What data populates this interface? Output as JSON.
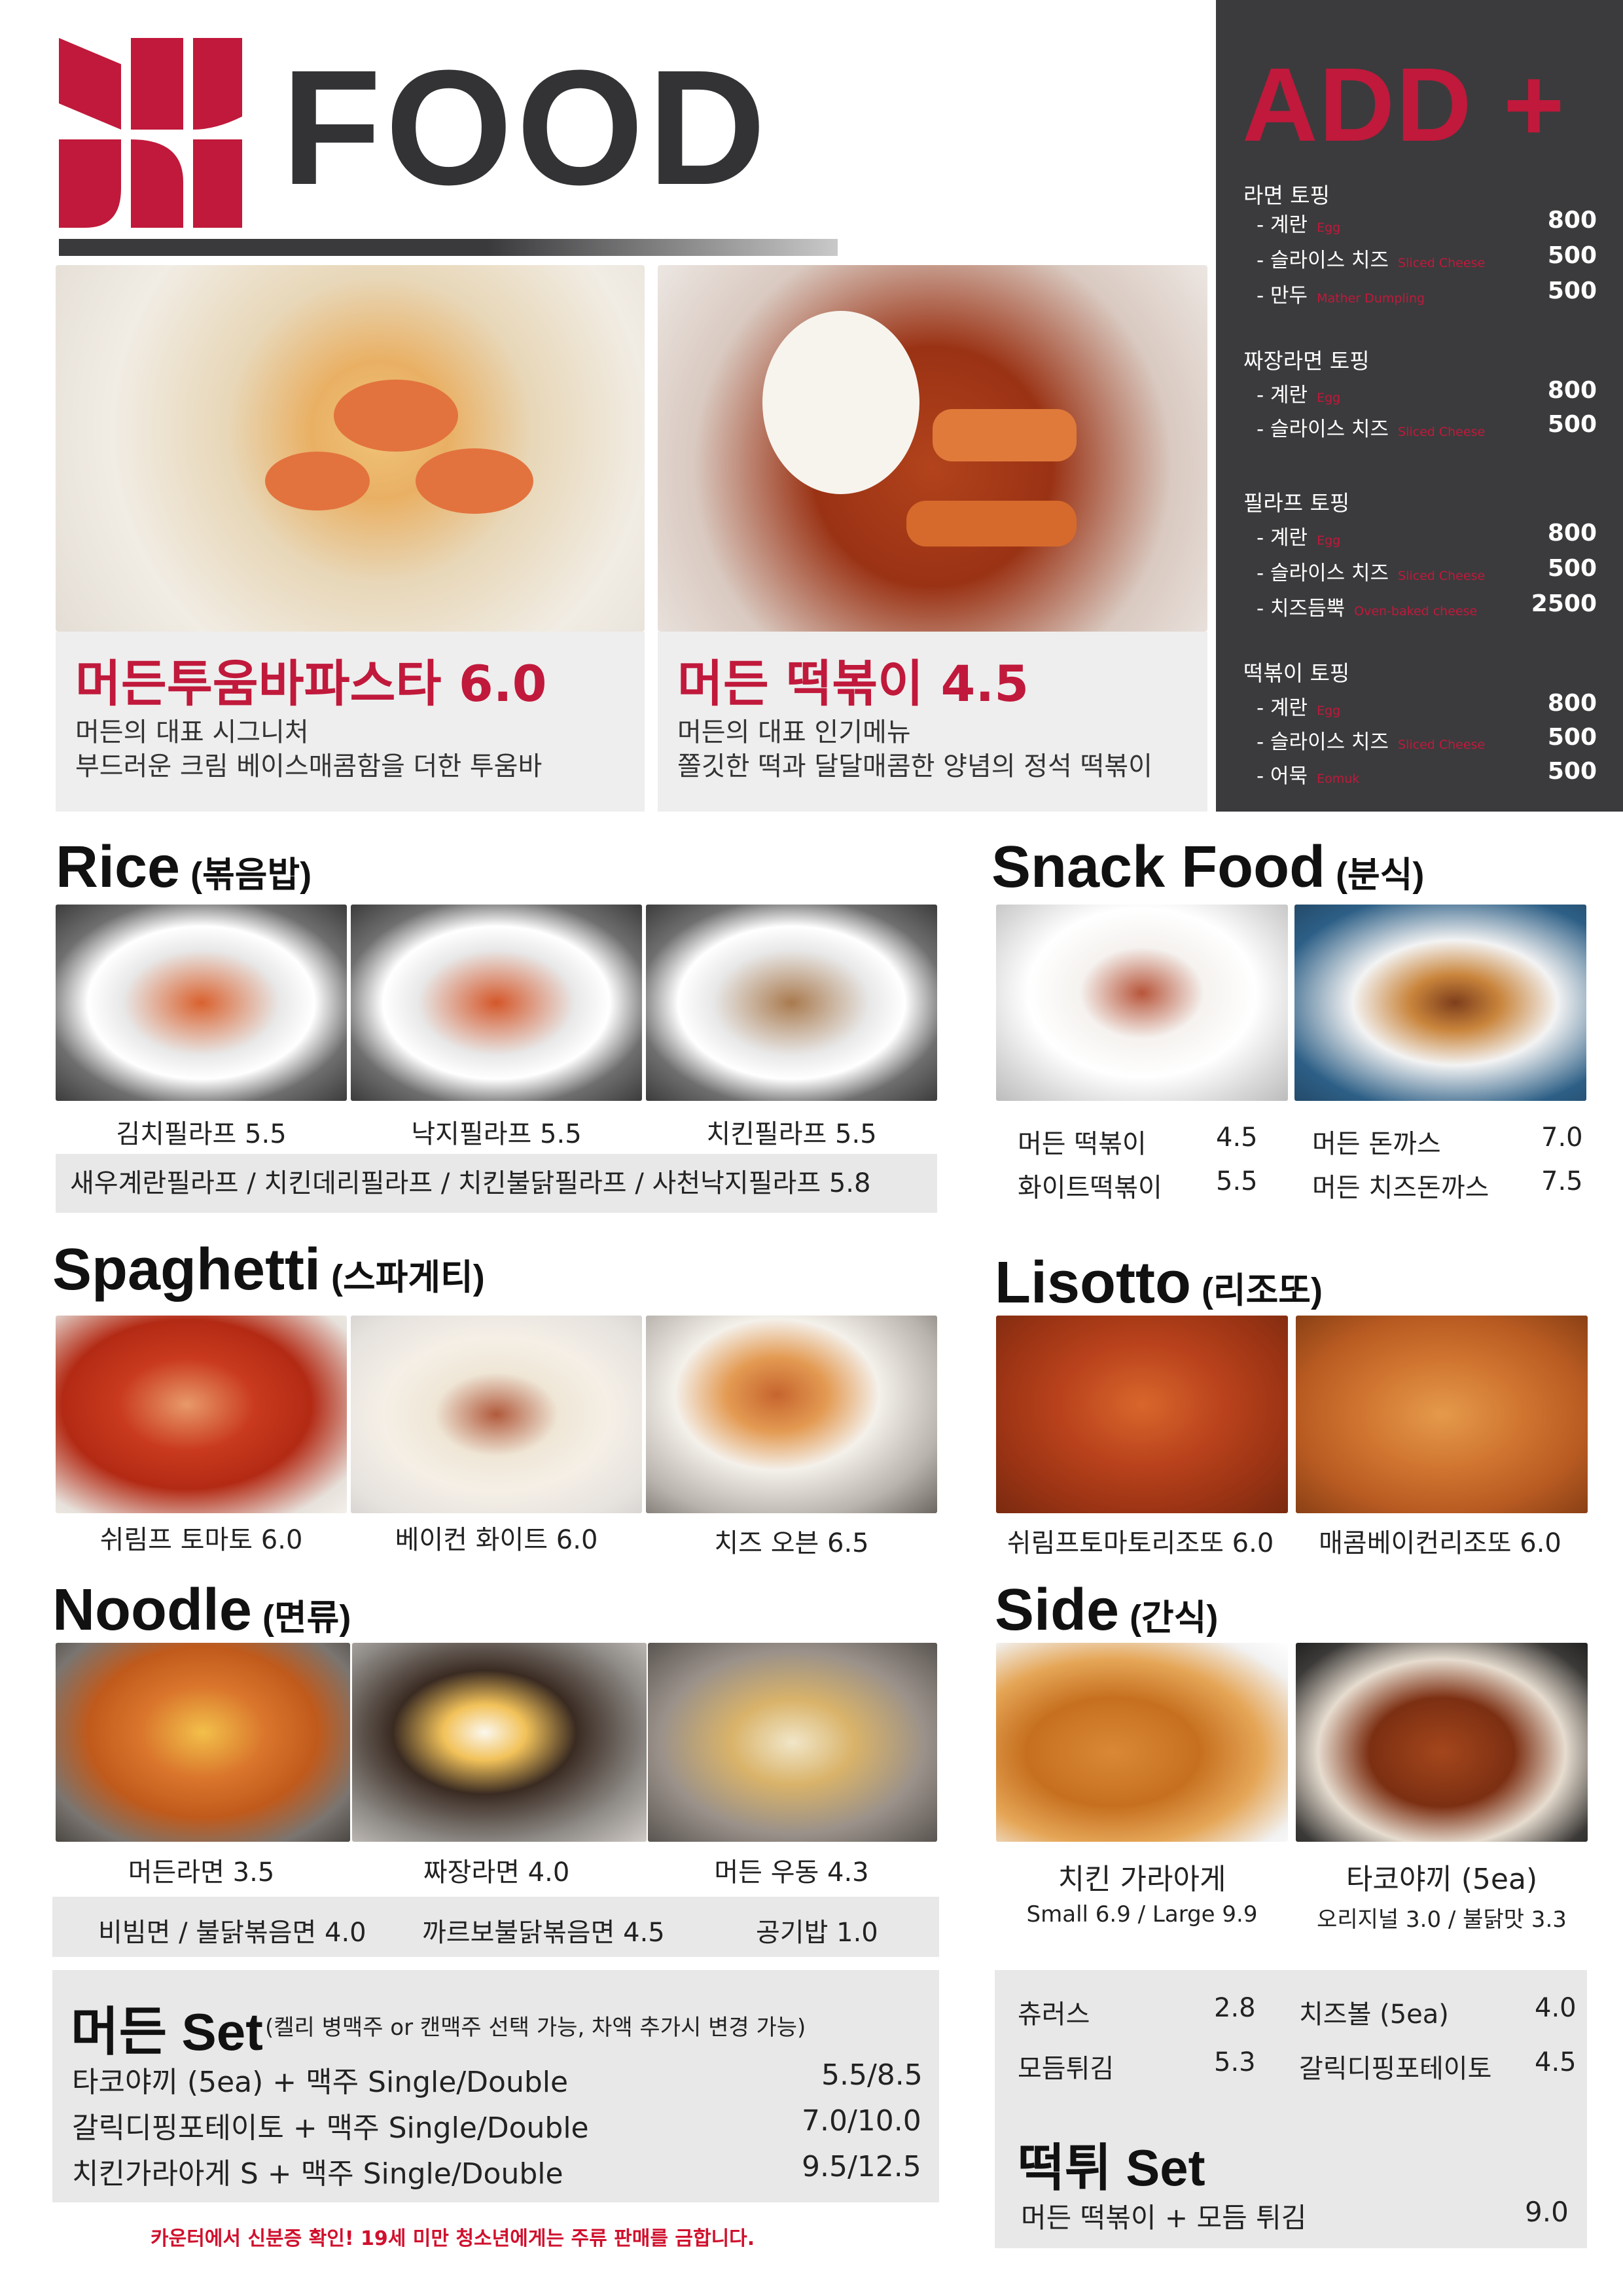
{
  "header": {
    "title": "FOOD"
  },
  "colors": {
    "brand": "#c0193b",
    "panel": "#3b3b3d",
    "bar": "#e8e8e8"
  },
  "hero": [
    {
      "title": "머든투움바파스타 6.0",
      "desc": "머든의 대표 시그니처\n부드러운 크림 베이스매콤함을 더한 투움바"
    },
    {
      "title": "머든 떡볶이 4.5",
      "desc": "머든의 대표 인기메뉴\n쫄깃한 떡과 달달매콤한 양념의 정석 떡볶이"
    }
  ],
  "add": {
    "title": "ADD +",
    "groups": [
      {
        "title": "라면 토핑",
        "items": [
          {
            "name": "- 계란",
            "en": "Egg",
            "price": "800"
          },
          {
            "name": "- 슬라이스 치즈",
            "en": "Sliced Cheese",
            "price": "500"
          },
          {
            "name": "- 만두",
            "en": "Mather Dumpling",
            "price": "500"
          }
        ]
      },
      {
        "title": "짜장라면 토핑",
        "items": [
          {
            "name": "- 계란",
            "en": "Egg",
            "price": "800"
          },
          {
            "name": "- 슬라이스 치즈",
            "en": "Sliced Cheese",
            "price": "500"
          }
        ]
      },
      {
        "title": "필라프 토핑",
        "items": [
          {
            "name": "- 계란",
            "en": "Egg",
            "price": "800"
          },
          {
            "name": "- 슬라이스 치즈",
            "en": "Sliced Cheese",
            "price": "500"
          },
          {
            "name": "- 치즈듬뿍",
            "en": "Oven-baked cheese",
            "price": "2500"
          }
        ]
      },
      {
        "title": "떡볶이 토핑",
        "items": [
          {
            "name": "- 계란",
            "en": "Egg",
            "price": "800"
          },
          {
            "name": "- 슬라이스 치즈",
            "en": "Sliced Cheese",
            "price": "500"
          },
          {
            "name": "- 어묵",
            "en": "Eomuk",
            "price": "500"
          }
        ]
      }
    ]
  },
  "rice": {
    "title": "Rice",
    "sub": "(볶음밥)",
    "items": [
      "김치필라프 5.5",
      "낙지필라프 5.5",
      "치킨필라프 5.5"
    ],
    "extra": "새우계란필라프 / 치킨데리필라프 / 치킨불닭필라프 / 사천낙지필라프 5.8"
  },
  "snack": {
    "title": "Snack Food",
    "sub": "(분식)",
    "rows": [
      [
        {
          "name": "머든 떡볶이",
          "price": "4.5"
        },
        {
          "name": "머든 돈까스",
          "price": "7.0"
        }
      ],
      [
        {
          "name": "화이트떡볶이",
          "price": "5.5"
        },
        {
          "name": "머든 치즈돈까스",
          "price": "7.5"
        }
      ]
    ]
  },
  "spaghetti": {
    "title": "Spaghetti",
    "sub": "(스파게티)",
    "items": [
      "쉬림프 토마토 6.0",
      "베이컨 화이트 6.0",
      "치즈 오븐 6.5"
    ]
  },
  "lisotto": {
    "title": "Lisotto",
    "sub": "(리조또)",
    "items": [
      "쉬림프토마토리조또 6.0",
      "매콤베이컨리조또 6.0"
    ]
  },
  "noodle": {
    "title": "Noodle",
    "sub": "(면류)",
    "items": [
      "머든라면 3.5",
      "짜장라면 4.0",
      "머든 우동 4.3"
    ],
    "extra": [
      "비빔면 / 불닭볶음면  4.0",
      "까르보불닭볶음면  4.5",
      "공기밥 1.0"
    ]
  },
  "side": {
    "title": "Side",
    "sub": "(간식)",
    "items": [
      {
        "name": "치킨 가라아게",
        "price": "Small 6.9 / Large 9.9"
      },
      {
        "name": "타코야끼 (5ea)",
        "price": "오리지널 3.0 / 불닭맛 3.3"
      }
    ],
    "rows": [
      [
        {
          "name": "츄러스",
          "price": "2.8"
        },
        {
          "name": "치즈볼 (5ea)",
          "price": "4.0"
        }
      ],
      [
        {
          "name": "모듬튀김",
          "price": "5.3"
        },
        {
          "name": "갈릭디핑포테이토",
          "price": "4.5"
        }
      ]
    ]
  },
  "set": {
    "title": "머든 Set",
    "note": "(켈리 병맥주 or 캔맥주 선택 가능, 차액 추가시 변경 가능)",
    "items": [
      {
        "name": "타코야끼 (5ea) + 맥주 Single/Double",
        "price": "5.5/8.5"
      },
      {
        "name": "갈릭디핑포테이토 + 맥주 Single/Double",
        "price": "7.0/10.0"
      },
      {
        "name": "치킨가라아게 S + 맥주 Single/Double",
        "price": "9.5/12.5"
      }
    ]
  },
  "ttwi_set": {
    "title": "떡튀 Set",
    "item": "머든 떡볶이 + 모듬 튀김",
    "price": "9.0"
  },
  "notice": "카운터에서 신분증 확인! 19세 미만 청소년에게는 주류 판매를 금합니다."
}
